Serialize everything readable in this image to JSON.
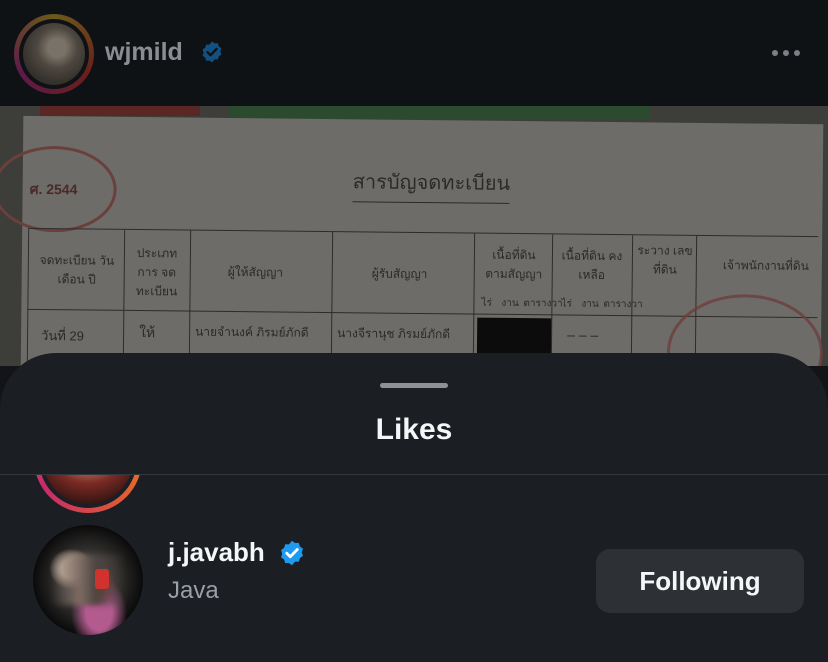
{
  "post": {
    "username": "wjmild",
    "verified": true,
    "more_icon": "more-horizontal-icon",
    "photo": {
      "stamp_left_text": "ศ. 2544",
      "document_title": "สารบัญจดทะเบียน",
      "headers": [
        "จดทะเบียน วัน เดือน ปี",
        "ประเภท การ จดทะเบียน",
        "ผู้ให้สัญญา",
        "ผู้รับสัญญา",
        "เนื้อที่ดิน ตามสัญญา",
        "เนื้อที่ดิน คงเหลือ",
        "ระวาง เลขที่ดิน",
        "เจ้าพนักงานที่ดิน"
      ],
      "sub_headers": [
        "ไร่",
        "งาน",
        "ตารางวา",
        "ไร่",
        "งาน",
        "ตารางวา"
      ],
      "row1": {
        "date": "วันที่ 29",
        "type": "ให้",
        "grantor": "นายจำนงค์ ภิรมย์ภักดี",
        "grantee": "นางจีรานุช ภิรมย์ภักดี",
        "dashes": "– – –"
      }
    }
  },
  "sheet": {
    "title": "Likes",
    "users": [
      {
        "username": "j.javabh",
        "full_name": "Java",
        "verified": true,
        "button_label": "Following"
      }
    ]
  },
  "colors": {
    "verified_blue": "#1e9bf0",
    "sheet_bg": "#1b1e22",
    "button_bg": "#2d3136"
  }
}
